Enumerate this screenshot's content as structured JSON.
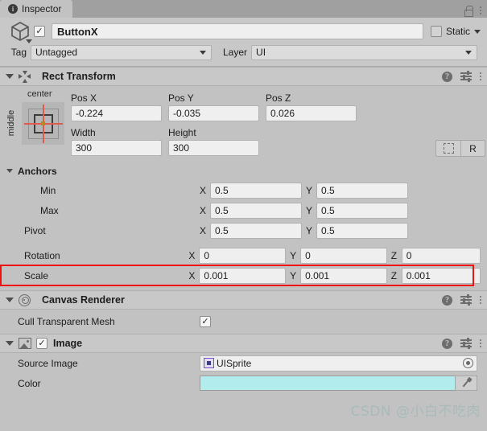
{
  "window": {
    "tab_label": "Inspector",
    "info_icon": "info-icon",
    "lock_icon": "lock-icon",
    "menu_icon": "kebab-menu-icon"
  },
  "object_header": {
    "icon": "cube-icon",
    "enabled_checkbox": "✓",
    "name": "ButtonX",
    "static_label": "Static",
    "static_checked": false,
    "tag_label": "Tag",
    "tag_value": "Untagged",
    "layer_label": "Layer",
    "layer_value": "UI"
  },
  "components": [
    {
      "title": "Rect Transform",
      "icon": "rect-transform-icon",
      "help_icon": "help-icon",
      "preset_icon": "preset-settings-icon",
      "menu_icon": "kebab-menu-icon"
    },
    {
      "title": "Canvas Renderer",
      "icon": "canvas-renderer-icon",
      "help_icon": "help-icon",
      "preset_icon": "preset-settings-icon",
      "menu_icon": "kebab-menu-icon"
    },
    {
      "title": "Image",
      "icon": "image-component-icon",
      "enabled_checkbox": "✓",
      "help_icon": "help-icon",
      "preset_icon": "preset-settings-icon",
      "menu_icon": "kebab-menu-icon"
    }
  ],
  "rect_transform": {
    "anchor_preset": {
      "horizontal_label": "center",
      "vertical_label": "middle",
      "crosshair_color": "#e05a4d",
      "pivot_dot_color": "#b58b1a"
    },
    "pos": {
      "x_label": "Pos X",
      "x_value": "-0.224",
      "y_label": "Pos Y",
      "y_value": "-0.035",
      "z_label": "Pos Z",
      "z_value": "0.026"
    },
    "size": {
      "width_label": "Width",
      "width_value": "300",
      "height_label": "Height",
      "height_value": "300"
    },
    "blueprint_button": "blueprint-mode-icon",
    "raw_button": "R",
    "anchors_label": "Anchors",
    "anchor_rows": [
      {
        "label": "Min",
        "x_axis": "X",
        "x_value": "0.5",
        "y_axis": "Y",
        "y_value": "0.5"
      },
      {
        "label": "Max",
        "x_axis": "X",
        "x_value": "0.5",
        "y_axis": "Y",
        "y_value": "0.5"
      }
    ],
    "pivot_row": {
      "label": "Pivot",
      "x_axis": "X",
      "x_value": "0.5",
      "y_axis": "Y",
      "y_value": "0.5"
    },
    "rotation_row": {
      "label": "Rotation",
      "x_axis": "X",
      "x_value": "0",
      "y_axis": "Y",
      "y_value": "0",
      "z_axis": "Z",
      "z_value": "0"
    },
    "scale_row": {
      "label": "Scale",
      "x_axis": "X",
      "x_value": "0.001",
      "y_axis": "Y",
      "y_value": "0.001",
      "z_axis": "Z",
      "z_value": "0.001",
      "highlight_color": "#ee1111"
    }
  },
  "canvas_renderer": {
    "cull_label": "Cull Transparent Mesh",
    "cull_checked": true,
    "cull_checkmark": "✓"
  },
  "image": {
    "source_image_label": "Source Image",
    "source_image_value": "UISprite",
    "sprite_icon": "sprite-thumbnail-icon",
    "picker_icon": "object-picker-icon",
    "color_label": "Color",
    "color_value": "#b3ecec",
    "eyedropper_icon": "eyedropper-icon"
  },
  "watermark": {
    "text": "CSDN @小白不吃肉"
  }
}
